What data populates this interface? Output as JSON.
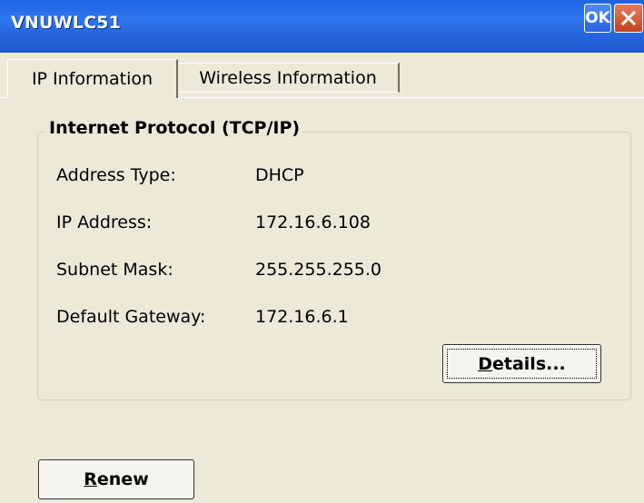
{
  "window": {
    "title": "VNUWLC51",
    "ok_label": "OK"
  },
  "tabs": [
    {
      "label": "IP Information",
      "active": true
    },
    {
      "label": "Wireless Information",
      "active": false
    }
  ],
  "group": {
    "title": "Internet Protocol (TCP/IP)",
    "rows": [
      {
        "label": "Address Type:",
        "value": "DHCP"
      },
      {
        "label": "IP Address:",
        "value": "172.16.6.108"
      },
      {
        "label": "Subnet Mask:",
        "value": "255.255.255.0"
      },
      {
        "label": "Default Gateway:",
        "value": "172.16.6.1"
      }
    ]
  },
  "buttons": {
    "details": {
      "mnemonic": "D",
      "rest": "etails..."
    },
    "renew": {
      "mnemonic": "R",
      "rest": "enew"
    }
  },
  "colors": {
    "titlebar": "#2f76ee",
    "background": "#ece9d8",
    "close_button": "#c4421f"
  }
}
